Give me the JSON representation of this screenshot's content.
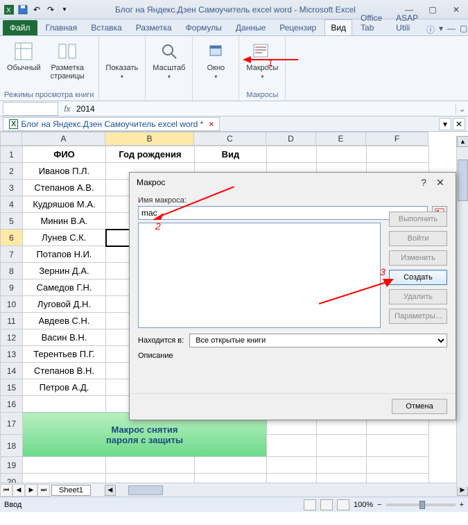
{
  "title": "Блог на Яндекс.Дзен Самоучитель excel word  -  Microsoft Excel",
  "tabs": {
    "file": "Файл",
    "items": [
      "Главная",
      "Вставка",
      "Разметка",
      "Формулы",
      "Данные",
      "Рецензир",
      "Вид",
      "Office Tab",
      "ASAP Utili"
    ],
    "active": 6
  },
  "ribbon": {
    "group_view_label": "Режимы просмотра книги",
    "btn_normal": "Обычный",
    "btn_layout": "Разметка\nстраницы",
    "btn_show": "Показать",
    "btn_zoom": "Масштаб",
    "btn_window": "Окно",
    "btn_macros": "Макросы",
    "group_macros_label": "Макросы"
  },
  "formula_bar": {
    "value": "2014"
  },
  "doc_tab": {
    "label": "Блог на Яндекс.Дзен Самоучитель excel word *"
  },
  "columns": [
    "A",
    "B",
    "C",
    "D",
    "E",
    "F"
  ],
  "headers": {
    "A": "ФИО",
    "B": "Год рождения",
    "C": "Вид"
  },
  "rows": [
    "Иванов П.Л.",
    "Степанов А.В.",
    "Кудряшов М.А.",
    "Минин В.А.",
    "Лунев С.К.",
    "Потапов Н.И.",
    "Зернин Д.А.",
    "Самедов Г.Н.",
    "Луговой Д.Н.",
    "Авдеев С.Н.",
    "Васин В.Н.",
    "Терентьев П.Г.",
    "Степанов В.Н.",
    "Петров А.Д."
  ],
  "green_banner": {
    "line1": "Макрос снятия",
    "line2": "пароля с защиты"
  },
  "dialog": {
    "title": "Макрос",
    "name_label": "Имя макроса:",
    "name_value": "mac",
    "location_label": "Находится в:",
    "location_value": "Все открытые книги",
    "desc_label": "Описание",
    "btn_run": "Выполнить",
    "btn_step": "Войти",
    "btn_edit": "Изменить",
    "btn_create": "Создать",
    "btn_delete": "Удалить",
    "btn_params": "Параметры...",
    "btn_cancel": "Отмена"
  },
  "annotations": {
    "n1": "1",
    "n2": "2",
    "n3": "3"
  },
  "sheet": {
    "tab": "Sheet1"
  },
  "status": {
    "mode": "Ввод",
    "zoom": "100%"
  }
}
